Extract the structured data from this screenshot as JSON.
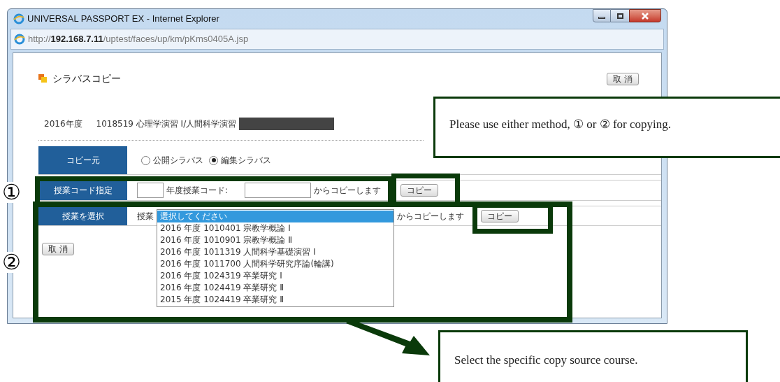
{
  "window": {
    "title": "UNIVERSAL PASSPORT EX - Internet Explorer",
    "url": "http://**192.168.7.11**/uptest/faces/up/km/pKms0405A.jsp"
  },
  "page": {
    "title": "シラバスコピー",
    "cancel_top": "取 消",
    "year": "2016年度",
    "course": "1018519 心理学演習 Ⅰ/人間科学演習",
    "cancel_bottom": "取 消"
  },
  "rows": [
    {
      "kind": "radio",
      "header": "コピー元",
      "options": [
        {
          "label": "公開シラバス",
          "selected": false
        },
        {
          "label": "編集シラバス",
          "selected": true
        }
      ]
    },
    {
      "kind": "code",
      "header": "授業コード指定",
      "label": "年度授業コード:",
      "suffix": "からコピーします",
      "button": "コピー"
    },
    {
      "kind": "select",
      "header": "授業を選択",
      "label": "授業",
      "suffix": "からコピーします",
      "button": "コピー",
      "options": [
        {
          "label": "選択してください",
          "selected": true
        },
        {
          "label": "2016 年度 1010401 宗教学概論 Ⅰ",
          "selected": false
        },
        {
          "label": "2016 年度 1010901 宗教学概論 Ⅱ",
          "selected": false
        },
        {
          "label": "2016 年度 1011319 人間科学基礎演習 Ⅰ",
          "selected": false
        },
        {
          "label": "2016 年度 1011700 人間科学研究序論(輪講)",
          "selected": false
        },
        {
          "label": "2016 年度 1024319 卒業研究 Ⅰ",
          "selected": false
        },
        {
          "label": "2016 年度 1024419 卒業研究 Ⅱ",
          "selected": false
        },
        {
          "label": "2015 年度 1024419 卒業研究 Ⅱ",
          "selected": false
        }
      ]
    }
  ],
  "annotations": {
    "markers": [
      "①",
      "②"
    ],
    "callout_top": "Please use either method, ① or ② for copying.",
    "callout_bottom": "Select the specific copy source course."
  }
}
